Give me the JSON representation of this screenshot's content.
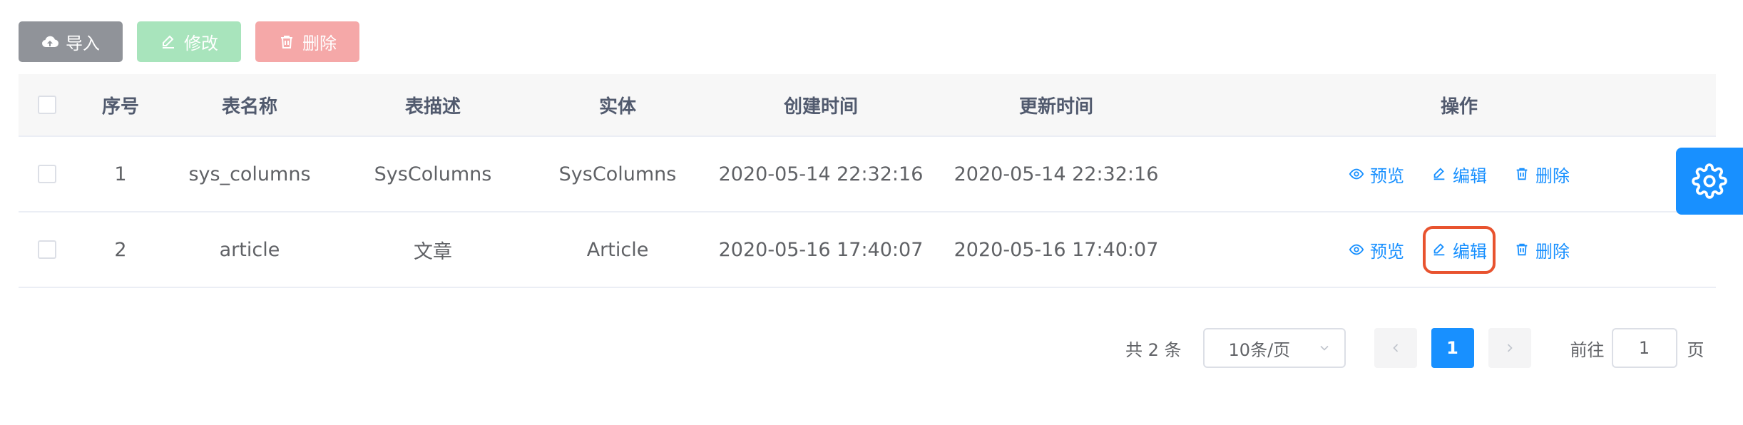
{
  "toolbar": {
    "import_label": "导入",
    "edit_label": "修改",
    "delete_label": "删除"
  },
  "table": {
    "headers": {
      "seq": "序号",
      "name": "表名称",
      "desc": "表描述",
      "entity": "实体",
      "created": "创建时间",
      "updated": "更新时间",
      "ops": "操作"
    },
    "rows": [
      {
        "seq": "1",
        "name": "sys_columns",
        "desc": "SysColumns",
        "entity": "SysColumns",
        "created": "2020-05-14 22:32:16",
        "updated": "2020-05-14 22:32:16"
      },
      {
        "seq": "2",
        "name": "article",
        "desc": "文章",
        "entity": "Article",
        "created": "2020-05-16 17:40:07",
        "updated": "2020-05-16 17:40:07"
      }
    ],
    "actions": {
      "preview": "预览",
      "edit": "编辑",
      "delete": "删除"
    }
  },
  "pagination": {
    "total_text": "共 2 条",
    "page_size": "10条/页",
    "current_page": "1",
    "goto_prefix": "前往",
    "goto_value": "1",
    "goto_suffix": "页"
  },
  "colors": {
    "primary": "#1890ff",
    "import_bg": "#909399",
    "edit_bg": "#a8e4bc",
    "delete_bg": "#f5a8a8",
    "highlight": "#e8532f"
  }
}
